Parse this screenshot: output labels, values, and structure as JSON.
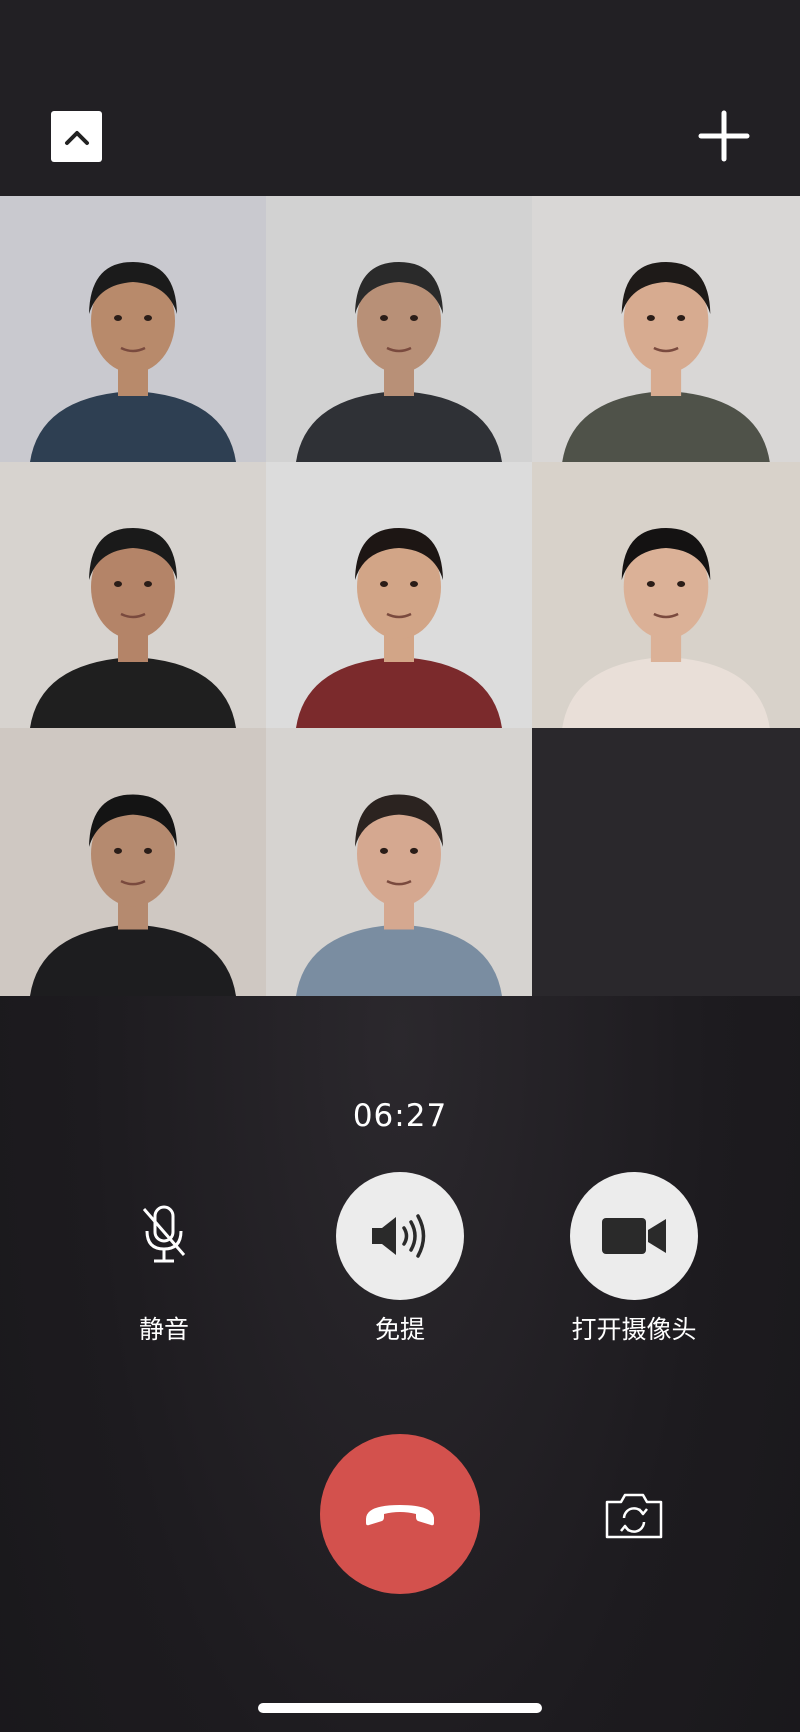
{
  "call": {
    "duration": "06:27"
  },
  "controls": {
    "mute": {
      "label": "静音",
      "icon": "microphone-off-icon"
    },
    "speaker": {
      "label": "免提",
      "icon": "speaker-icon"
    },
    "camera": {
      "label": "打开摄像头",
      "icon": "video-camera-icon"
    },
    "hangup": {
      "icon": "phone-hangup-icon",
      "color": "#d3514d"
    },
    "flip_camera": {
      "icon": "camera-flip-icon"
    }
  },
  "top_bar": {
    "collapse": {
      "icon": "chevron-up-icon"
    },
    "add_member": {
      "icon": "plus-icon"
    }
  },
  "participants": [
    {
      "bg": "#c9c9cf",
      "skin": "#b88a6b",
      "hair": "#1b1b1b",
      "shirt": "#2e3f52"
    },
    {
      "bg": "#d2d2d2",
      "skin": "#b89077",
      "hair": "#2a2a2a",
      "shirt": "#2f3136"
    },
    {
      "bg": "#d9d7d6",
      "skin": "#d7ab90",
      "hair": "#1e1a18",
      "shirt": "#4f5249"
    },
    {
      "bg": "#d7d3cf",
      "skin": "#b48468",
      "hair": "#1a1a1a",
      "shirt": "#1f1f1f"
    },
    {
      "bg": "#dcdcdc",
      "skin": "#d2a587",
      "hair": "#1d1614",
      "shirt": "#7b2a2c"
    },
    {
      "bg": "#d8d2ca",
      "skin": "#dbb197",
      "hair": "#141212",
      "shirt": "#e9dfd8"
    },
    {
      "bg": "#cfc8c2",
      "skin": "#b58a6f",
      "hair": "#141414",
      "shirt": "#1d1d1f"
    },
    {
      "bg": "#d6d3d0",
      "skin": "#d5a890",
      "hair": "#2b2320",
      "shirt": "#7a8da1"
    }
  ],
  "colors": {
    "background": "#1d1b1f",
    "button_light": "#ececec"
  }
}
